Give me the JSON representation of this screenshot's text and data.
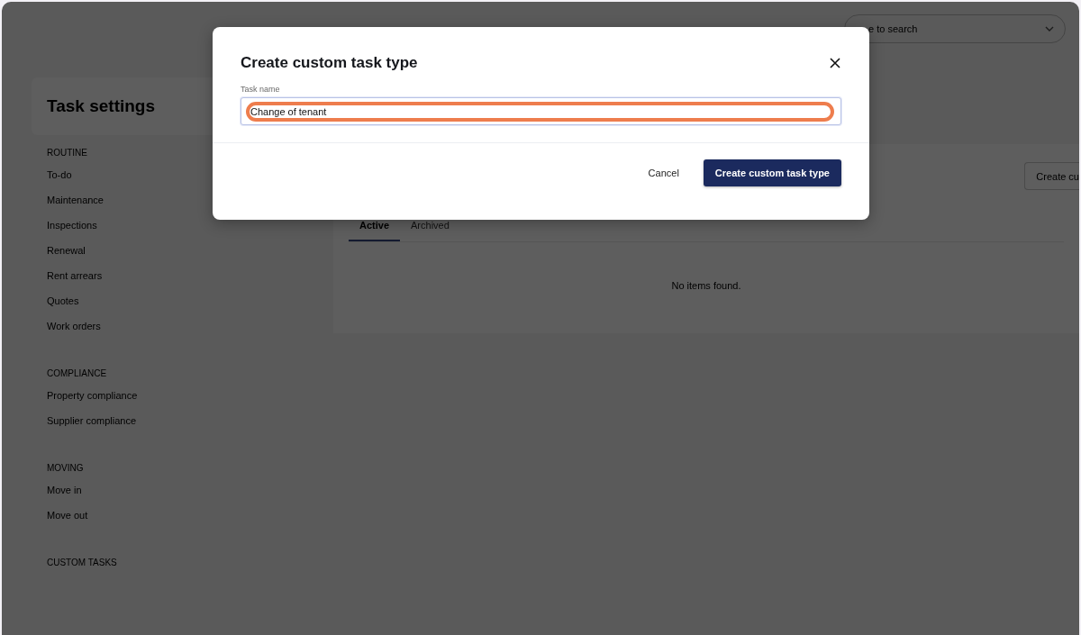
{
  "top_bar": {
    "search": {
      "placeholder": "e to search"
    }
  },
  "sidebar": {
    "title": "Task settings",
    "sections": [
      {
        "heading": "ROUTINE",
        "items": [
          "To-do",
          "Maintenance",
          "Inspections",
          "Renewal",
          "Rent arrears",
          "Quotes",
          "Work orders"
        ]
      },
      {
        "heading": "COMPLIANCE",
        "items": [
          "Property compliance",
          "Supplier compliance"
        ]
      },
      {
        "heading": "MOVING",
        "items": [
          "Move in",
          "Move out"
        ]
      },
      {
        "heading": "CUSTOM TASKS"
      }
    ]
  },
  "main": {
    "create_button": "Create cu",
    "tabs": [
      {
        "label": "Active",
        "selected": true
      },
      {
        "label": "Archived",
        "selected": false
      }
    ],
    "empty_text": "No items found."
  },
  "dialog": {
    "title": "Create custom task type",
    "field": {
      "label": "Task name",
      "value": "Change of tenant",
      "highlighted": true
    },
    "buttons": [
      {
        "label": "Cancel",
        "kind": "secondary"
      },
      {
        "label": "Create custom task type",
        "kind": "primary"
      }
    ]
  }
}
